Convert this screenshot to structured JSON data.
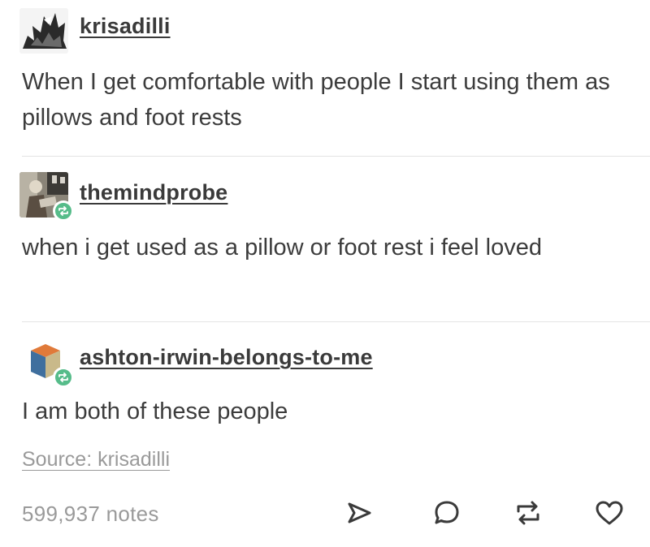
{
  "post": {
    "entries": [
      {
        "username": "krisadilli",
        "text": "When I get comfortable with people I start using them as pillows and foot rests",
        "is_reblog": false
      },
      {
        "username": "themindprobe",
        "text": "when i get used as a pillow or foot rest i feel loved",
        "is_reblog": true
      },
      {
        "username": "ashton-irwin-belongs-to-me",
        "text": "I am both of these people",
        "is_reblog": true
      }
    ],
    "source_label": "Source: krisadilli",
    "notes_label": "599,937 notes"
  },
  "colors": {
    "reblog_badge": "#56bc8a",
    "text": "#3c3c3c",
    "muted": "#9a9a9a"
  },
  "icons": [
    "share-icon",
    "reply-icon",
    "reblog-icon",
    "like-icon"
  ]
}
